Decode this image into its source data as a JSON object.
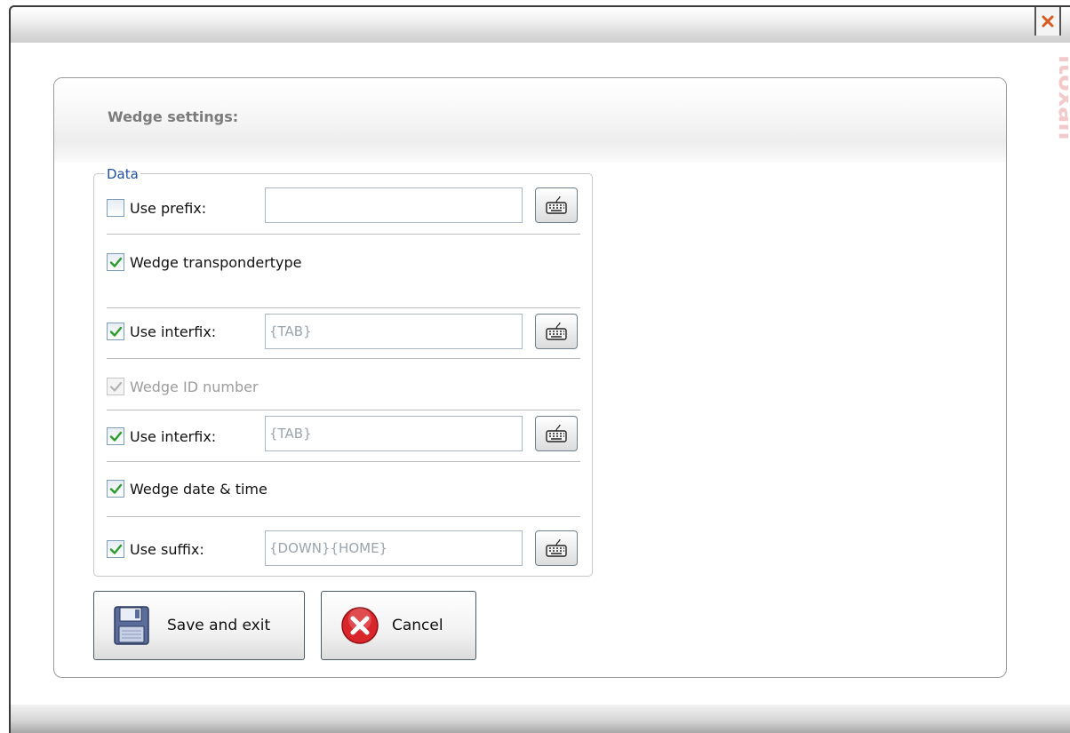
{
  "panel": {
    "title": "Wedge settings:"
  },
  "group": {
    "legend": "Data"
  },
  "rows": {
    "prefix": {
      "label": "Use prefix:",
      "checked": false,
      "value": ""
    },
    "transponder": {
      "label": "Wedge transpondertype",
      "checked": true
    },
    "interfix1": {
      "label": "Use interfix:",
      "checked": true,
      "value": "{TAB}"
    },
    "idnumber": {
      "label": "Wedge ID number",
      "checked": true,
      "disabled": true
    },
    "interfix2": {
      "label": "Use interfix:",
      "checked": true,
      "value": "{TAB}"
    },
    "datetime": {
      "label": "Wedge date & time",
      "checked": true
    },
    "suffix": {
      "label": "Use suffix:",
      "checked": true,
      "value": "{DOWN}{HOME}"
    }
  },
  "buttons": {
    "save_label": "Save and exit",
    "cancel_label": "Cancel"
  },
  "brand": {
    "text": "itoxan"
  },
  "colors": {
    "check": "#2c9c2c",
    "legend": "#1f4fa3",
    "close": "#d95a1f",
    "cancel_red": "#d8262a",
    "brand": "#f3c9c9"
  },
  "icons": {
    "close": "close-icon",
    "keyboard": "keyboard-icon",
    "save": "floppy-disk-icon",
    "cancel": "cancel-icon"
  }
}
